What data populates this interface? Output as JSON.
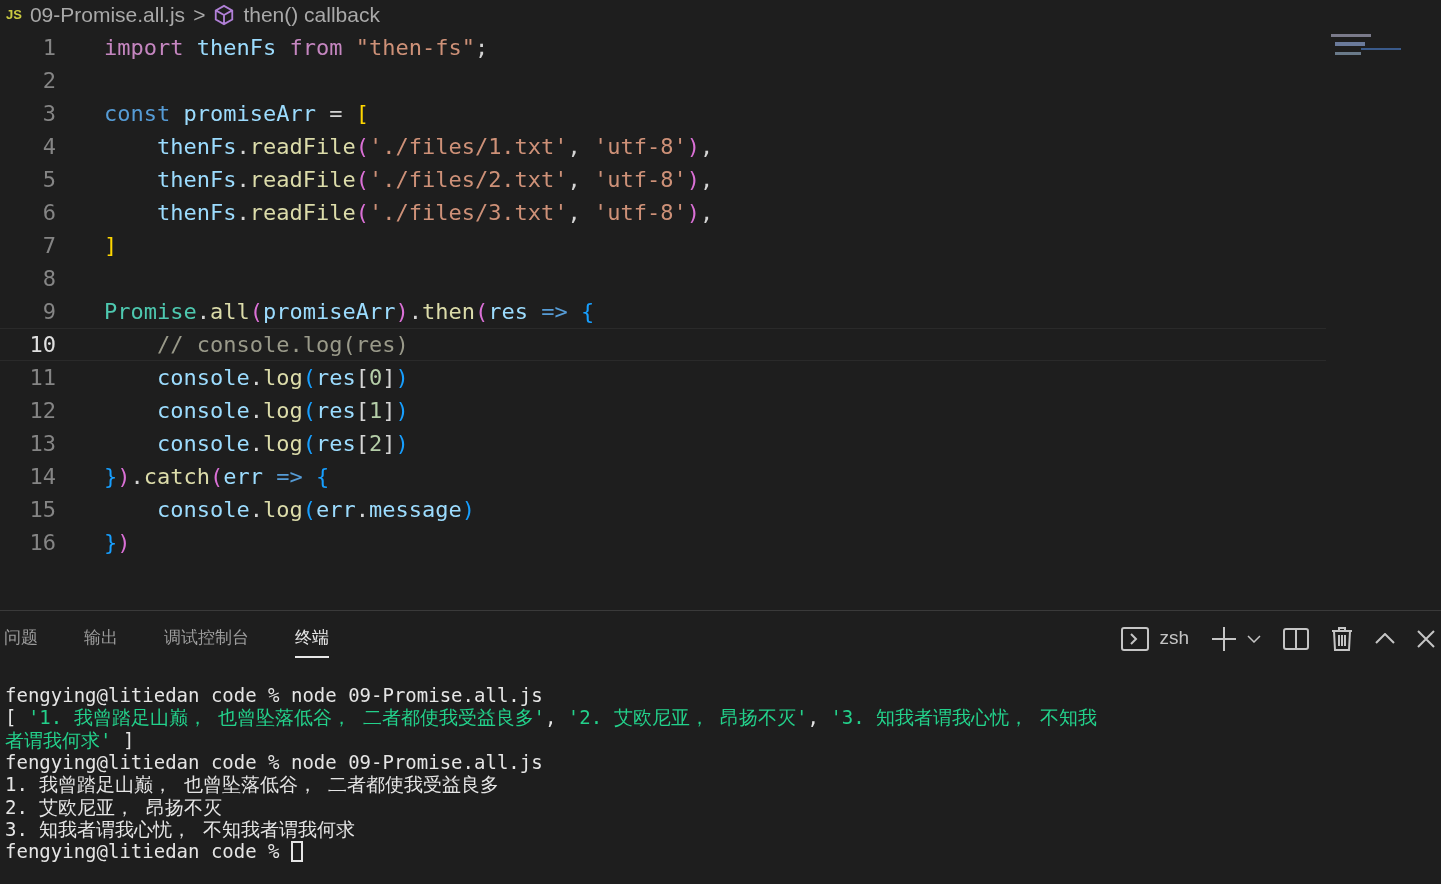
{
  "breadcrumb": {
    "file_badge": "JS",
    "file": "09-Promise.all.js",
    "separator": ">",
    "symbol": "then() callback"
  },
  "editor": {
    "lines": [
      {
        "number": "1",
        "current": false,
        "tokens": [
          {
            "kind": "kw",
            "text": "import "
          },
          {
            "kind": "var",
            "text": "thenFs "
          },
          {
            "kind": "kw",
            "text": "from "
          },
          {
            "kind": "str",
            "text": "\"then-fs\""
          },
          {
            "kind": "punc",
            "text": ";"
          }
        ]
      },
      {
        "number": "2",
        "current": false
      },
      {
        "number": "3",
        "current": false,
        "tokens": [
          {
            "kind": "storage",
            "text": "const "
          },
          {
            "kind": "var",
            "text": "promiseArr"
          },
          {
            "kind": "punc",
            "text": " = "
          },
          {
            "kind": "b1",
            "text": "["
          }
        ]
      },
      {
        "number": "4",
        "current": false,
        "tokens": [
          {
            "kind": "var",
            "text": "    thenFs"
          },
          {
            "kind": "punc",
            "text": "."
          },
          {
            "kind": "fn",
            "text": "readFile"
          },
          {
            "kind": "b2",
            "text": "("
          },
          {
            "kind": "str",
            "text": "'./files/1.txt'"
          },
          {
            "kind": "punc",
            "text": ", "
          },
          {
            "kind": "str",
            "text": "'utf-8'"
          },
          {
            "kind": "b2",
            "text": ")"
          },
          {
            "kind": "punc",
            "text": ","
          }
        ]
      },
      {
        "number": "5",
        "current": false,
        "tokens": [
          {
            "kind": "var",
            "text": "    thenFs"
          },
          {
            "kind": "punc",
            "text": "."
          },
          {
            "kind": "fn",
            "text": "readFile"
          },
          {
            "kind": "b2",
            "text": "("
          },
          {
            "kind": "str",
            "text": "'./files/2.txt'"
          },
          {
            "kind": "punc",
            "text": ", "
          },
          {
            "kind": "str",
            "text": "'utf-8'"
          },
          {
            "kind": "b2",
            "text": ")"
          },
          {
            "kind": "punc",
            "text": ","
          }
        ]
      },
      {
        "number": "6",
        "current": false,
        "tokens": [
          {
            "kind": "var",
            "text": "    thenFs"
          },
          {
            "kind": "punc",
            "text": "."
          },
          {
            "kind": "fn",
            "text": "readFile"
          },
          {
            "kind": "b2",
            "text": "("
          },
          {
            "kind": "str",
            "text": "'./files/3.txt'"
          },
          {
            "kind": "punc",
            "text": ", "
          },
          {
            "kind": "str",
            "text": "'utf-8'"
          },
          {
            "kind": "b2",
            "text": ")"
          },
          {
            "kind": "punc",
            "text": ","
          }
        ]
      },
      {
        "number": "7",
        "current": false,
        "tokens": [
          {
            "kind": "b1",
            "text": "]"
          }
        ]
      },
      {
        "number": "8",
        "current": false
      },
      {
        "number": "9",
        "current": false,
        "tokens": [
          {
            "kind": "cls",
            "text": "Promise"
          },
          {
            "kind": "punc",
            "text": "."
          },
          {
            "kind": "fn",
            "text": "all"
          },
          {
            "kind": "b2",
            "text": "("
          },
          {
            "kind": "var",
            "text": "promiseArr"
          },
          {
            "kind": "b2",
            "text": ")"
          },
          {
            "kind": "punc",
            "text": "."
          },
          {
            "kind": "fn",
            "text": "then"
          },
          {
            "kind": "b2",
            "text": "("
          },
          {
            "kind": "var",
            "text": "res"
          },
          {
            "kind": "storage",
            "text": " => "
          },
          {
            "kind": "b3",
            "text": "{"
          }
        ]
      },
      {
        "number": "10",
        "current": true,
        "tokens": [
          {
            "kind": "comment",
            "text": "    // console.log(res)"
          }
        ]
      },
      {
        "number": "11",
        "current": false,
        "tokens": [
          {
            "kind": "var",
            "text": "    console"
          },
          {
            "kind": "punc",
            "text": "."
          },
          {
            "kind": "fn",
            "text": "log"
          },
          {
            "kind": "b3",
            "text": "("
          },
          {
            "kind": "var",
            "text": "res"
          },
          {
            "kind": "punc",
            "text": "["
          },
          {
            "kind": "num",
            "text": "0"
          },
          {
            "kind": "punc",
            "text": "]"
          },
          {
            "kind": "b3",
            "text": ")"
          }
        ]
      },
      {
        "number": "12",
        "current": false,
        "tokens": [
          {
            "kind": "var",
            "text": "    console"
          },
          {
            "kind": "punc",
            "text": "."
          },
          {
            "kind": "fn",
            "text": "log"
          },
          {
            "kind": "b3",
            "text": "("
          },
          {
            "kind": "var",
            "text": "res"
          },
          {
            "kind": "punc",
            "text": "["
          },
          {
            "kind": "num",
            "text": "1"
          },
          {
            "kind": "punc",
            "text": "]"
          },
          {
            "kind": "b3",
            "text": ")"
          }
        ]
      },
      {
        "number": "13",
        "current": false,
        "tokens": [
          {
            "kind": "var",
            "text": "    console"
          },
          {
            "kind": "punc",
            "text": "."
          },
          {
            "kind": "fn",
            "text": "log"
          },
          {
            "kind": "b3",
            "text": "("
          },
          {
            "kind": "var",
            "text": "res"
          },
          {
            "kind": "punc",
            "text": "["
          },
          {
            "kind": "num",
            "text": "2"
          },
          {
            "kind": "punc",
            "text": "]"
          },
          {
            "kind": "b3",
            "text": ")"
          }
        ]
      },
      {
        "number": "14",
        "current": false,
        "tokens": [
          {
            "kind": "b3",
            "text": "}"
          },
          {
            "kind": "b2",
            "text": ")"
          },
          {
            "kind": "punc",
            "text": "."
          },
          {
            "kind": "fn",
            "text": "catch"
          },
          {
            "kind": "b2",
            "text": "("
          },
          {
            "kind": "var",
            "text": "err"
          },
          {
            "kind": "storage",
            "text": " => "
          },
          {
            "kind": "b3",
            "text": "{"
          }
        ]
      },
      {
        "number": "15",
        "current": false,
        "tokens": [
          {
            "kind": "var",
            "text": "    console"
          },
          {
            "kind": "punc",
            "text": "."
          },
          {
            "kind": "fn",
            "text": "log"
          },
          {
            "kind": "b3",
            "text": "("
          },
          {
            "kind": "var",
            "text": "err"
          },
          {
            "kind": "punc",
            "text": "."
          },
          {
            "kind": "var",
            "text": "message"
          },
          {
            "kind": "b3",
            "text": ")"
          }
        ]
      },
      {
        "number": "16",
        "current": false,
        "tokens": [
          {
            "kind": "b3",
            "text": "}"
          },
          {
            "kind": "b2",
            "text": ")"
          }
        ]
      }
    ]
  },
  "panel": {
    "tabs": [
      {
        "label": "问题",
        "selected": false
      },
      {
        "label": "输出",
        "selected": false
      },
      {
        "label": "调试控制台",
        "selected": false
      },
      {
        "label": "终端",
        "selected": true
      }
    ],
    "shell": "zsh"
  },
  "terminal": {
    "lines": [
      [
        {
          "kind": "plain",
          "text": "fengying@litiedan code % node 09-Promise.all.js"
        }
      ],
      [
        {
          "kind": "plain",
          "text": "[ "
        },
        {
          "kind": "str",
          "text": "'1. 我曾踏足山巅， 也曾坠落低谷， 二者都使我受益良多'"
        },
        {
          "kind": "plain",
          "text": ", "
        },
        {
          "kind": "str",
          "text": "'2. 艾欧尼亚， 昂扬不灭'"
        },
        {
          "kind": "plain",
          "text": ", "
        },
        {
          "kind": "str",
          "text": "'3. 知我者谓我心忧， 不知我"
        }
      ],
      [
        {
          "kind": "str",
          "text": "者谓我何求'"
        },
        {
          "kind": "plain",
          "text": " ]"
        }
      ],
      [
        {
          "kind": "plain",
          "text": "fengying@litiedan code % node 09-Promise.all.js"
        }
      ],
      [
        {
          "kind": "plain",
          "text": "1. 我曾踏足山巅， 也曾坠落低谷， 二者都使我受益良多"
        }
      ],
      [
        {
          "kind": "plain",
          "text": "2. 艾欧尼亚， 昂扬不灭"
        }
      ],
      [
        {
          "kind": "plain",
          "text": "3. 知我者谓我心忧， 不知我者谓我何求"
        }
      ],
      [
        {
          "kind": "plain",
          "text": "fengying@litiedan code % "
        }
      ]
    ],
    "cursor": true
  }
}
